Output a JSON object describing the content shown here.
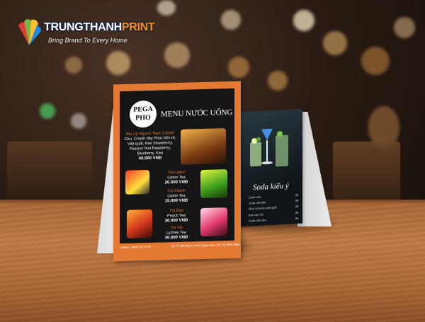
{
  "brand": {
    "name_part1": "TRUNGTHANH",
    "name_part2": "PRINT",
    "tagline": "Bring Brand To Every Home",
    "accent_color": "#ff8a1a",
    "logo_icon": "leaf-fan-icon"
  },
  "menu_front": {
    "logo_line1": "PEGA",
    "logo_line2": "PHO",
    "title": "MENU NƯỚC UỐNG",
    "frame_color": "#e27a34",
    "items": [
      {
        "name": "Bia Up Ngược Tiger Crystal",
        "desc": "Cờu, Chanh dây Phúc bồn tử, Việt quất, Kiwi Strawberry, Passion fruit Raspberry, Blueberry, Kiwi",
        "price": "40.000 VNĐ"
      },
      {
        "name": "Trà Lipton",
        "desc": "Lipton Tea",
        "price": "20.000 VNĐ"
      },
      {
        "name": "Trà Chanh",
        "desc": "Lipton Tea",
        "price": "15.000 VNĐ"
      },
      {
        "name": "Trà Đào",
        "desc": "Peach Tea",
        "price": "30.000 VNĐ"
      },
      {
        "name": "Trà Vải",
        "desc": "Lychee Tea",
        "price": "30.000 VNĐ"
      }
    ],
    "hotline": "Hotline : 0936 315 9716",
    "address": "32 TK NGUYEN, KHU 2 Quan Kiet | ĐT: 08 3924 8864"
  },
  "menu_back": {
    "title": "Soda kiểu ý",
    "items": [
      {
        "name": "Soda siêu",
        "price": "34"
      },
      {
        "name": "Soda việt đào",
        "price": "34"
      },
      {
        "name": "Blue curacao việt quất",
        "price": "34"
      },
      {
        "name": "Kiwi bạc hà",
        "price": "34"
      },
      {
        "name": "Soda nho đen",
        "price": "34"
      }
    ]
  }
}
